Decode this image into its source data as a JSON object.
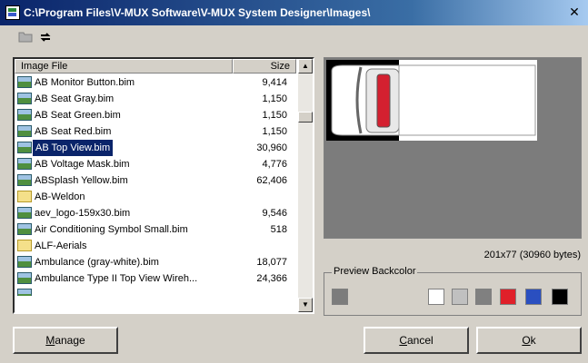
{
  "window": {
    "title": "C:\\Program Files\\V-MUX Software\\V-MUX System Designer\\Images\\",
    "close_glyph": "✕"
  },
  "toolbar": {
    "buttons": [
      {
        "icon": "folder-icon"
      },
      {
        "icon": "refresh-icon"
      }
    ]
  },
  "file_list": {
    "columns": {
      "name": "Image File",
      "size": "Size"
    },
    "rows": [
      {
        "name": "AB Monitor Button.bim",
        "size": "9,414",
        "type": "file"
      },
      {
        "name": "AB Seat Gray.bim",
        "size": "1,150",
        "type": "file"
      },
      {
        "name": "AB Seat Green.bim",
        "size": "1,150",
        "type": "file"
      },
      {
        "name": "AB Seat Red.bim",
        "size": "1,150",
        "type": "file"
      },
      {
        "name": "AB Top View.bim",
        "size": "30,960",
        "type": "file",
        "selected": true
      },
      {
        "name": "AB Voltage Mask.bim",
        "size": "4,776",
        "type": "file"
      },
      {
        "name": "ABSplash Yellow.bim",
        "size": "62,406",
        "type": "file"
      },
      {
        "name": "AB-Weldon",
        "size": "",
        "type": "folder"
      },
      {
        "name": "aev_logo-159x30.bim",
        "size": "9,546",
        "type": "file"
      },
      {
        "name": "Air Conditioning Symbol Small.bim",
        "size": "518",
        "type": "file"
      },
      {
        "name": "ALF-Aerials",
        "size": "",
        "type": "folder"
      },
      {
        "name": "Ambulance (gray-white).bim",
        "size": "18,077",
        "type": "file"
      },
      {
        "name": "Ambulance Type II Top View Wireh...",
        "size": "24,366",
        "type": "file"
      }
    ]
  },
  "preview": {
    "dimensions_label": "201x77 (30960 bytes)",
    "backcolor_legend": "Preview Backcolor",
    "current_color": "#7c7c7c",
    "swatches": [
      "#ffffff",
      "#c0c0c0",
      "#808080",
      "#e0202a",
      "#2a4fc0",
      "#000000"
    ]
  },
  "buttons": {
    "manage": {
      "first": "M",
      "rest": "anage"
    },
    "cancel": {
      "first": "C",
      "rest": "ancel"
    },
    "ok": {
      "first": "O",
      "rest": "k"
    }
  }
}
